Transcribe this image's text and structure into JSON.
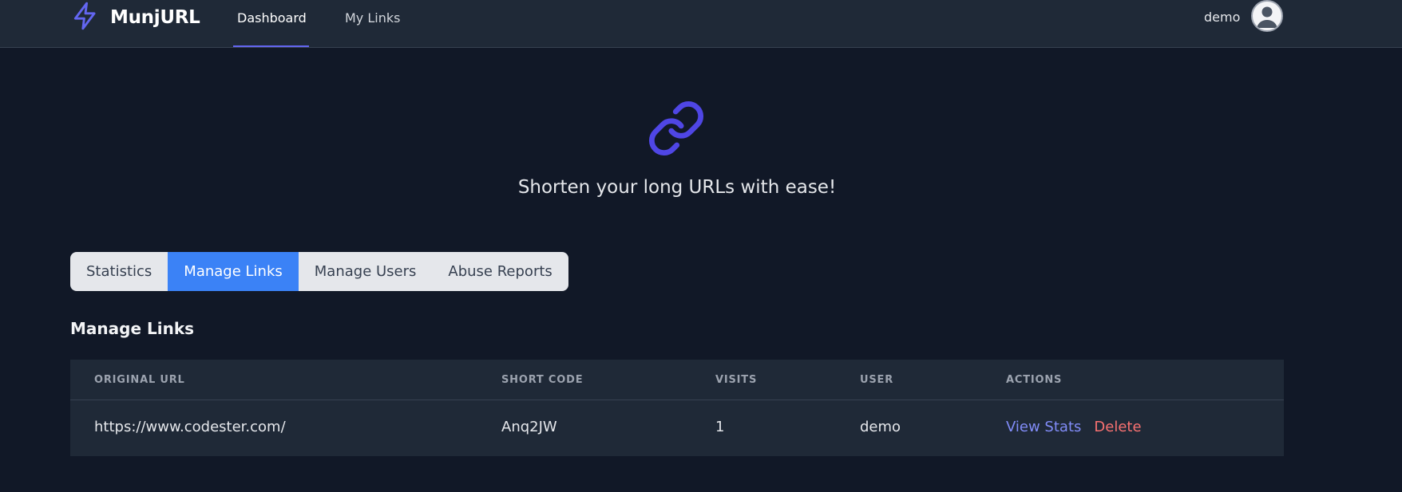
{
  "app": {
    "name": "MunjURL"
  },
  "nav": {
    "dashboard": "Dashboard",
    "my_links": "My Links"
  },
  "user": {
    "name": "demo"
  },
  "hero": {
    "tagline": "Shorten your long URLs with ease!"
  },
  "tabs": [
    "Statistics",
    "Manage Links",
    "Manage Users",
    "Abuse Reports"
  ],
  "active_tab": "Manage Links",
  "section": {
    "title": "Manage Links"
  },
  "table": {
    "headers": [
      "ORIGINAL URL",
      "SHORT CODE",
      "VISITS",
      "USER",
      "ACTIONS"
    ],
    "rows": [
      {
        "url": "https://www.codester.com/",
        "code": "Anq2JW",
        "visits": "1",
        "user": "demo",
        "actions": {
          "view": "View Stats",
          "delete": "Delete"
        }
      }
    ]
  },
  "colors": {
    "accent": "#6366f1",
    "tab_active": "#3b82f6",
    "link": "#818cf8",
    "danger": "#f87171",
    "background": "#111827",
    "surface": "#1f2937"
  },
  "icons": {
    "brand": "lightning-bolt-icon",
    "avatar": "user-avatar-icon",
    "hero": "link-chain-icon"
  }
}
